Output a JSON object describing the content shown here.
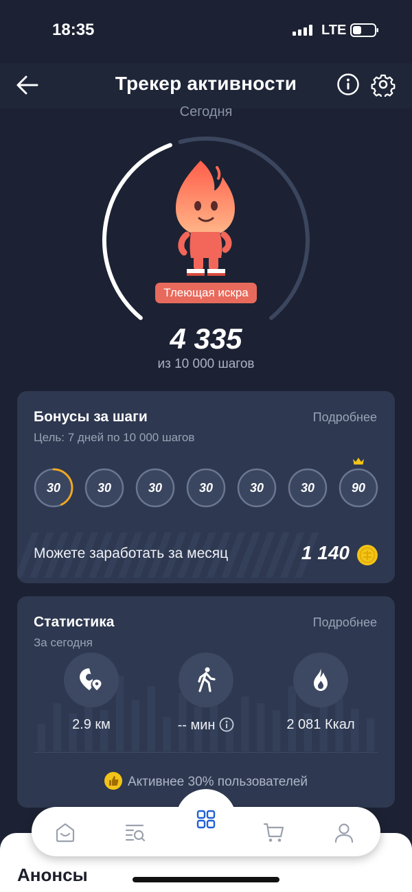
{
  "status_bar": {
    "time": "18:35",
    "network": "LTE"
  },
  "header": {
    "title": "Трекер активности"
  },
  "tracker": {
    "period_label": "Сегодня",
    "level_name": "Тлеющая искра",
    "steps": "4 335",
    "goal_text": "из 10 000 шагов",
    "progress_fraction": 0.4335
  },
  "bonus_card": {
    "title": "Бонусы за шаги",
    "more_label": "Подробнее",
    "subtitle": "Цель: 7 дней по 10 000 шагов",
    "days": [
      {
        "value": "30",
        "progress": 0.43
      },
      {
        "value": "30",
        "progress": 0
      },
      {
        "value": "30",
        "progress": 0
      },
      {
        "value": "30",
        "progress": 0
      },
      {
        "value": "30",
        "progress": 0
      },
      {
        "value": "30",
        "progress": 0
      },
      {
        "value": "90",
        "progress": 0
      }
    ],
    "earn_label": "Можете заработать за месяц",
    "earn_value": "1 140"
  },
  "stats_card": {
    "title": "Статистика",
    "more_label": "Подробнее",
    "subtitle": "За сегодня",
    "items": [
      {
        "icon": "location-pin-icon",
        "value": "2.9 км"
      },
      {
        "icon": "walking-person-icon",
        "value": "-- мин"
      },
      {
        "icon": "flame-icon",
        "value": "2 081 Ккал"
      }
    ],
    "comparison": "Активнее 30% пользователей"
  },
  "bottom_sheet": {
    "title": "Анонсы"
  },
  "nav": [
    "home-icon",
    "catalog-search-icon",
    "apps-grid-icon",
    "cart-icon",
    "profile-icon"
  ],
  "colors": {
    "background": "#1c2233",
    "card": "#2e3850",
    "accent_coin": "#f2c318",
    "level_badge": "#e86a5c",
    "active_nav": "#1f5fd6"
  }
}
